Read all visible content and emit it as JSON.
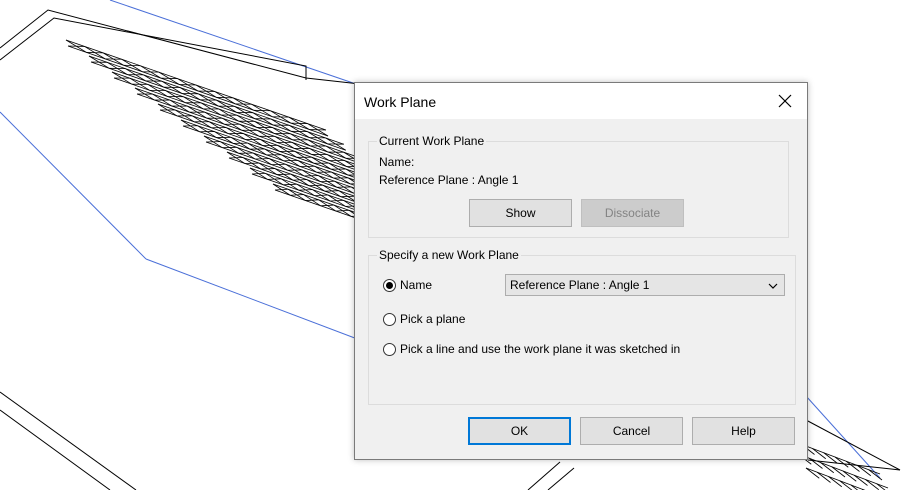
{
  "dialog": {
    "title": "Work Plane",
    "close_icon": "close-icon",
    "current": {
      "legend": "Current Work Plane",
      "name_label": "Name:",
      "name_value": "Reference Plane : Angle 1",
      "show_label": "Show",
      "dissociate_label": "Dissociate"
    },
    "specify": {
      "legend": "Specify a new Work Plane",
      "name_option": "Name",
      "name_selected": "Reference Plane : Angle 1",
      "pick_plane_option": "Pick a plane",
      "pick_line_option": "Pick a line and use the work plane it was sketched in",
      "selected_option": "name"
    },
    "buttons": {
      "ok": "OK",
      "cancel": "Cancel",
      "help": "Help"
    }
  },
  "colors": {
    "accent": "#0078d7",
    "reference_line": "#4a6fd8",
    "model_line": "#000000"
  }
}
